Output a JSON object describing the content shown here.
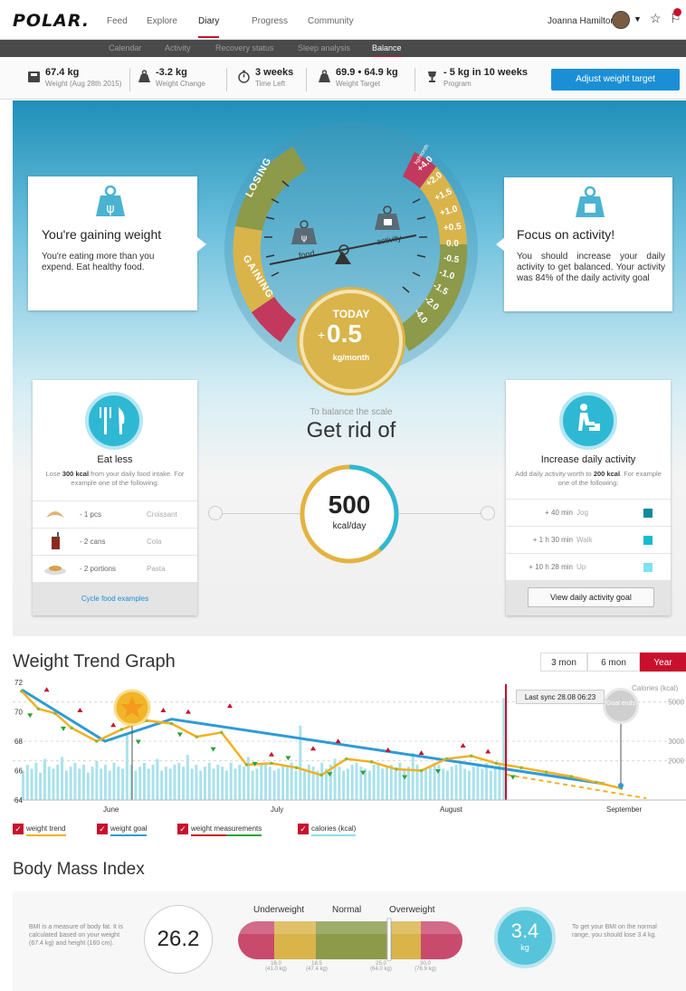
{
  "nav": {
    "logo": "POLAR.",
    "items": [
      "Feed",
      "Explore",
      "Diary",
      "Progress",
      "Community"
    ],
    "active": "Diary",
    "user": "Joanna Hamilton",
    "sub_items": [
      "Calendar",
      "Activity",
      "Recovery status",
      "Sleep analysis",
      "Balance"
    ],
    "sub_active": "Balance"
  },
  "stats": [
    {
      "value": "67.4 kg",
      "label": "Weight (Aug 28th 2015)",
      "icon": "scale-icon"
    },
    {
      "value": "-3.2 kg",
      "label": "Weight Change",
      "icon": "weight-icon"
    },
    {
      "value": "3 weeks",
      "label": "Time Left",
      "icon": "stopwatch-icon"
    },
    {
      "value": "69.9 • 64.9 kg",
      "label": "Weight Target",
      "icon": "weight-icon"
    },
    {
      "value": "- 5 kg in 10 weeks",
      "label": "Program",
      "icon": "trophy-icon"
    }
  ],
  "adjust_button": "Adjust weight target",
  "balance": {
    "left_card": {
      "title": "You're gaining weight",
      "text": "You're eating more than you expend. Eat healthy food."
    },
    "right_card": {
      "title": "Focus on activity!",
      "text": "You should increase your daily activity to get balanced. Your activity was 84% of the daily activity goal"
    },
    "gauge": {
      "losing": "LOSING",
      "gaining": "GAINING",
      "food": "food",
      "activity": "activity",
      "unit_top": "kg/month",
      "scale": [
        "+4.0",
        "+2.0",
        "+1.5",
        "+1.0",
        "+0.5",
        "0.0",
        "-0.5",
        "-1.0",
        "-1.5",
        "-2.0",
        "-4.0"
      ],
      "today_label": "TODAY",
      "today_sign": "+",
      "today_value": "0.5",
      "today_unit": "kg/month"
    },
    "to_balance": "To balance the scale",
    "get_rid_of": "Get rid of",
    "target_value": "500",
    "target_unit": "kcal/day",
    "eat_less": {
      "title": "Eat less",
      "text_pre": "Lose ",
      "text_bold": "300 kcal",
      "text_post": " from your daily food intake. For example one of the following:",
      "rows": [
        {
          "amount": "- 1 pcs",
          "item": "Croissant",
          "icon": "croissant-icon"
        },
        {
          "amount": "- 2 cans",
          "item": "Cola",
          "icon": "cola-icon"
        },
        {
          "amount": "- 2 portions",
          "item": "Pasta",
          "icon": "pasta-icon"
        }
      ],
      "cycle": "Cycle food examples"
    },
    "increase": {
      "title": "Increase daily activity",
      "text_pre": "Add daily activity worth to ",
      "text_bold": "200 kcal",
      "text_post": ". For example one of the following:",
      "rows": [
        {
          "duration": "+ 40 min",
          "activity": "Jog",
          "color": "#138a9a"
        },
        {
          "duration": "+ 1 h 30 min",
          "activity": "Walk",
          "color": "#1bbad0"
        },
        {
          "duration": "+ 10 h 28 min",
          "activity": "Up",
          "color": "#7fe2ee"
        }
      ],
      "button": "View daily activity goal"
    }
  },
  "trend": {
    "title": "Weight Trend Graph",
    "ranges": [
      "3 mon",
      "6 mon",
      "Year"
    ],
    "range_active": "Year",
    "last_sync": "Last sync 28.08 06:23",
    "goal": "Goal ends",
    "calories_label": "Calories (kcal)",
    "legend": [
      "weight trend",
      "weight goal",
      "weight measurements",
      "calories (kcal)"
    ]
  },
  "chart_data": {
    "type": "line",
    "title": "",
    "x_labels": [
      "June",
      "July",
      "August",
      "September"
    ],
    "y_ticks": [
      64,
      66,
      68,
      70,
      72
    ],
    "y2_ticks": [
      2000,
      3000,
      5000
    ],
    "ylim": [
      64,
      72
    ],
    "y2lim": [
      0,
      6000
    ],
    "weight_trend": [
      [
        0,
        71.4
      ],
      [
        4,
        70.2
      ],
      [
        8,
        69.9
      ],
      [
        12,
        68.9
      ],
      [
        18,
        68.0
      ],
      [
        24,
        68.8
      ],
      [
        30,
        69.4
      ],
      [
        36,
        69.2
      ],
      [
        42,
        68.3
      ],
      [
        48,
        68.6
      ],
      [
        54,
        66.4
      ],
      [
        60,
        66.5
      ],
      [
        66,
        66.2
      ],
      [
        72,
        65.7
      ],
      [
        78,
        66.8
      ],
      [
        84,
        66.6
      ],
      [
        90,
        66.1
      ],
      [
        96,
        66.0
      ],
      [
        102,
        66.8
      ],
      [
        108,
        67.0
      ],
      [
        114,
        66.5
      ],
      [
        120,
        66.2
      ],
      [
        126,
        65.9
      ],
      [
        132,
        65.6
      ],
      [
        138,
        65.2
      ],
      [
        144,
        64.8
      ]
    ],
    "weight_goal": [
      [
        0,
        71.5
      ],
      [
        20,
        68.0
      ],
      [
        36,
        69.5
      ],
      [
        140,
        65.1
      ]
    ],
    "measurements_up": [
      [
        6,
        71.0
      ],
      [
        14,
        69.6
      ],
      [
        22,
        68.6
      ],
      [
        26,
        69.3
      ],
      [
        34,
        69.6
      ],
      [
        40,
        69.5
      ],
      [
        50,
        69.9
      ],
      [
        60,
        66.6
      ],
      [
        70,
        67.0
      ],
      [
        76,
        67.5
      ],
      [
        88,
        66.9
      ],
      [
        96,
        66.7
      ],
      [
        106,
        67.2
      ],
      [
        112,
        66.8
      ]
    ],
    "measurements_down": [
      [
        2,
        70.2
      ],
      [
        10,
        69.3
      ],
      [
        28,
        68.4
      ],
      [
        38,
        68.9
      ],
      [
        46,
        67.9
      ],
      [
        56,
        66.9
      ],
      [
        64,
        67.3
      ],
      [
        74,
        66.2
      ],
      [
        82,
        66.3
      ],
      [
        92,
        66.0
      ],
      [
        100,
        66.4
      ],
      [
        118,
        66.0
      ]
    ],
    "calories": [
      1500,
      1800,
      1600,
      1900,
      1400,
      2100,
      1700,
      1600,
      1800,
      2200,
      1500,
      1700,
      1900,
      1600,
      1800,
      1400,
      1700,
      2000,
      1600,
      1800,
      1500,
      1900,
      1700,
      1600,
      3400,
      1800,
      1500,
      1700,
      1900,
      1600,
      1800,
      2100,
      1500,
      1700,
      1600,
      1800,
      1900,
      1700,
      2300,
      1600,
      1800,
      1500,
      1700,
      1900,
      1600,
      1800,
      1700,
      1500,
      1900,
      1600,
      1800,
      1700,
      2200,
      1500,
      1600,
      1800,
      1900,
      1700,
      1500,
      1600,
      1800,
      1700,
      1900,
      1500,
      3800,
      1600,
      1800,
      1700,
      1500,
      1900,
      1600,
      1800,
      2100,
      1700,
      1500,
      1600,
      1800,
      1900,
      1700,
      1600,
      1500,
      1800,
      1900,
      1600,
      1700,
      1800,
      1500,
      1900,
      1600,
      1700,
      2400,
      1800,
      1500,
      1600,
      1700,
      1900,
      1800,
      1600,
      1500,
      1700,
      1800,
      1900,
      1600,
      1500,
      1700,
      1800,
      1600,
      1900,
      1500,
      1700,
      1800,
      5200
    ]
  },
  "bmi": {
    "title": "Body Mass Index",
    "description": "BMI is a measure of body fat. It is calculated based on your weight (67.4 kg) and height (160 cm).",
    "value": "26.2",
    "categories": [
      "Underweight",
      "Normal",
      "Overweight"
    ],
    "ticks": [
      {
        "value": "16.0",
        "kg": "(41.0 kg)"
      },
      {
        "value": "18.5",
        "kg": "(47.4 kg)"
      },
      {
        "value": "25.0",
        "kg": "(64.0 kg)"
      },
      {
        "value": "30.0",
        "kg": "(76.9 kg)"
      }
    ],
    "lose_value": "3.4",
    "lose_unit": "kg",
    "advice": "To get your BMI on the normal range, you should lose 3.4 kg."
  }
}
